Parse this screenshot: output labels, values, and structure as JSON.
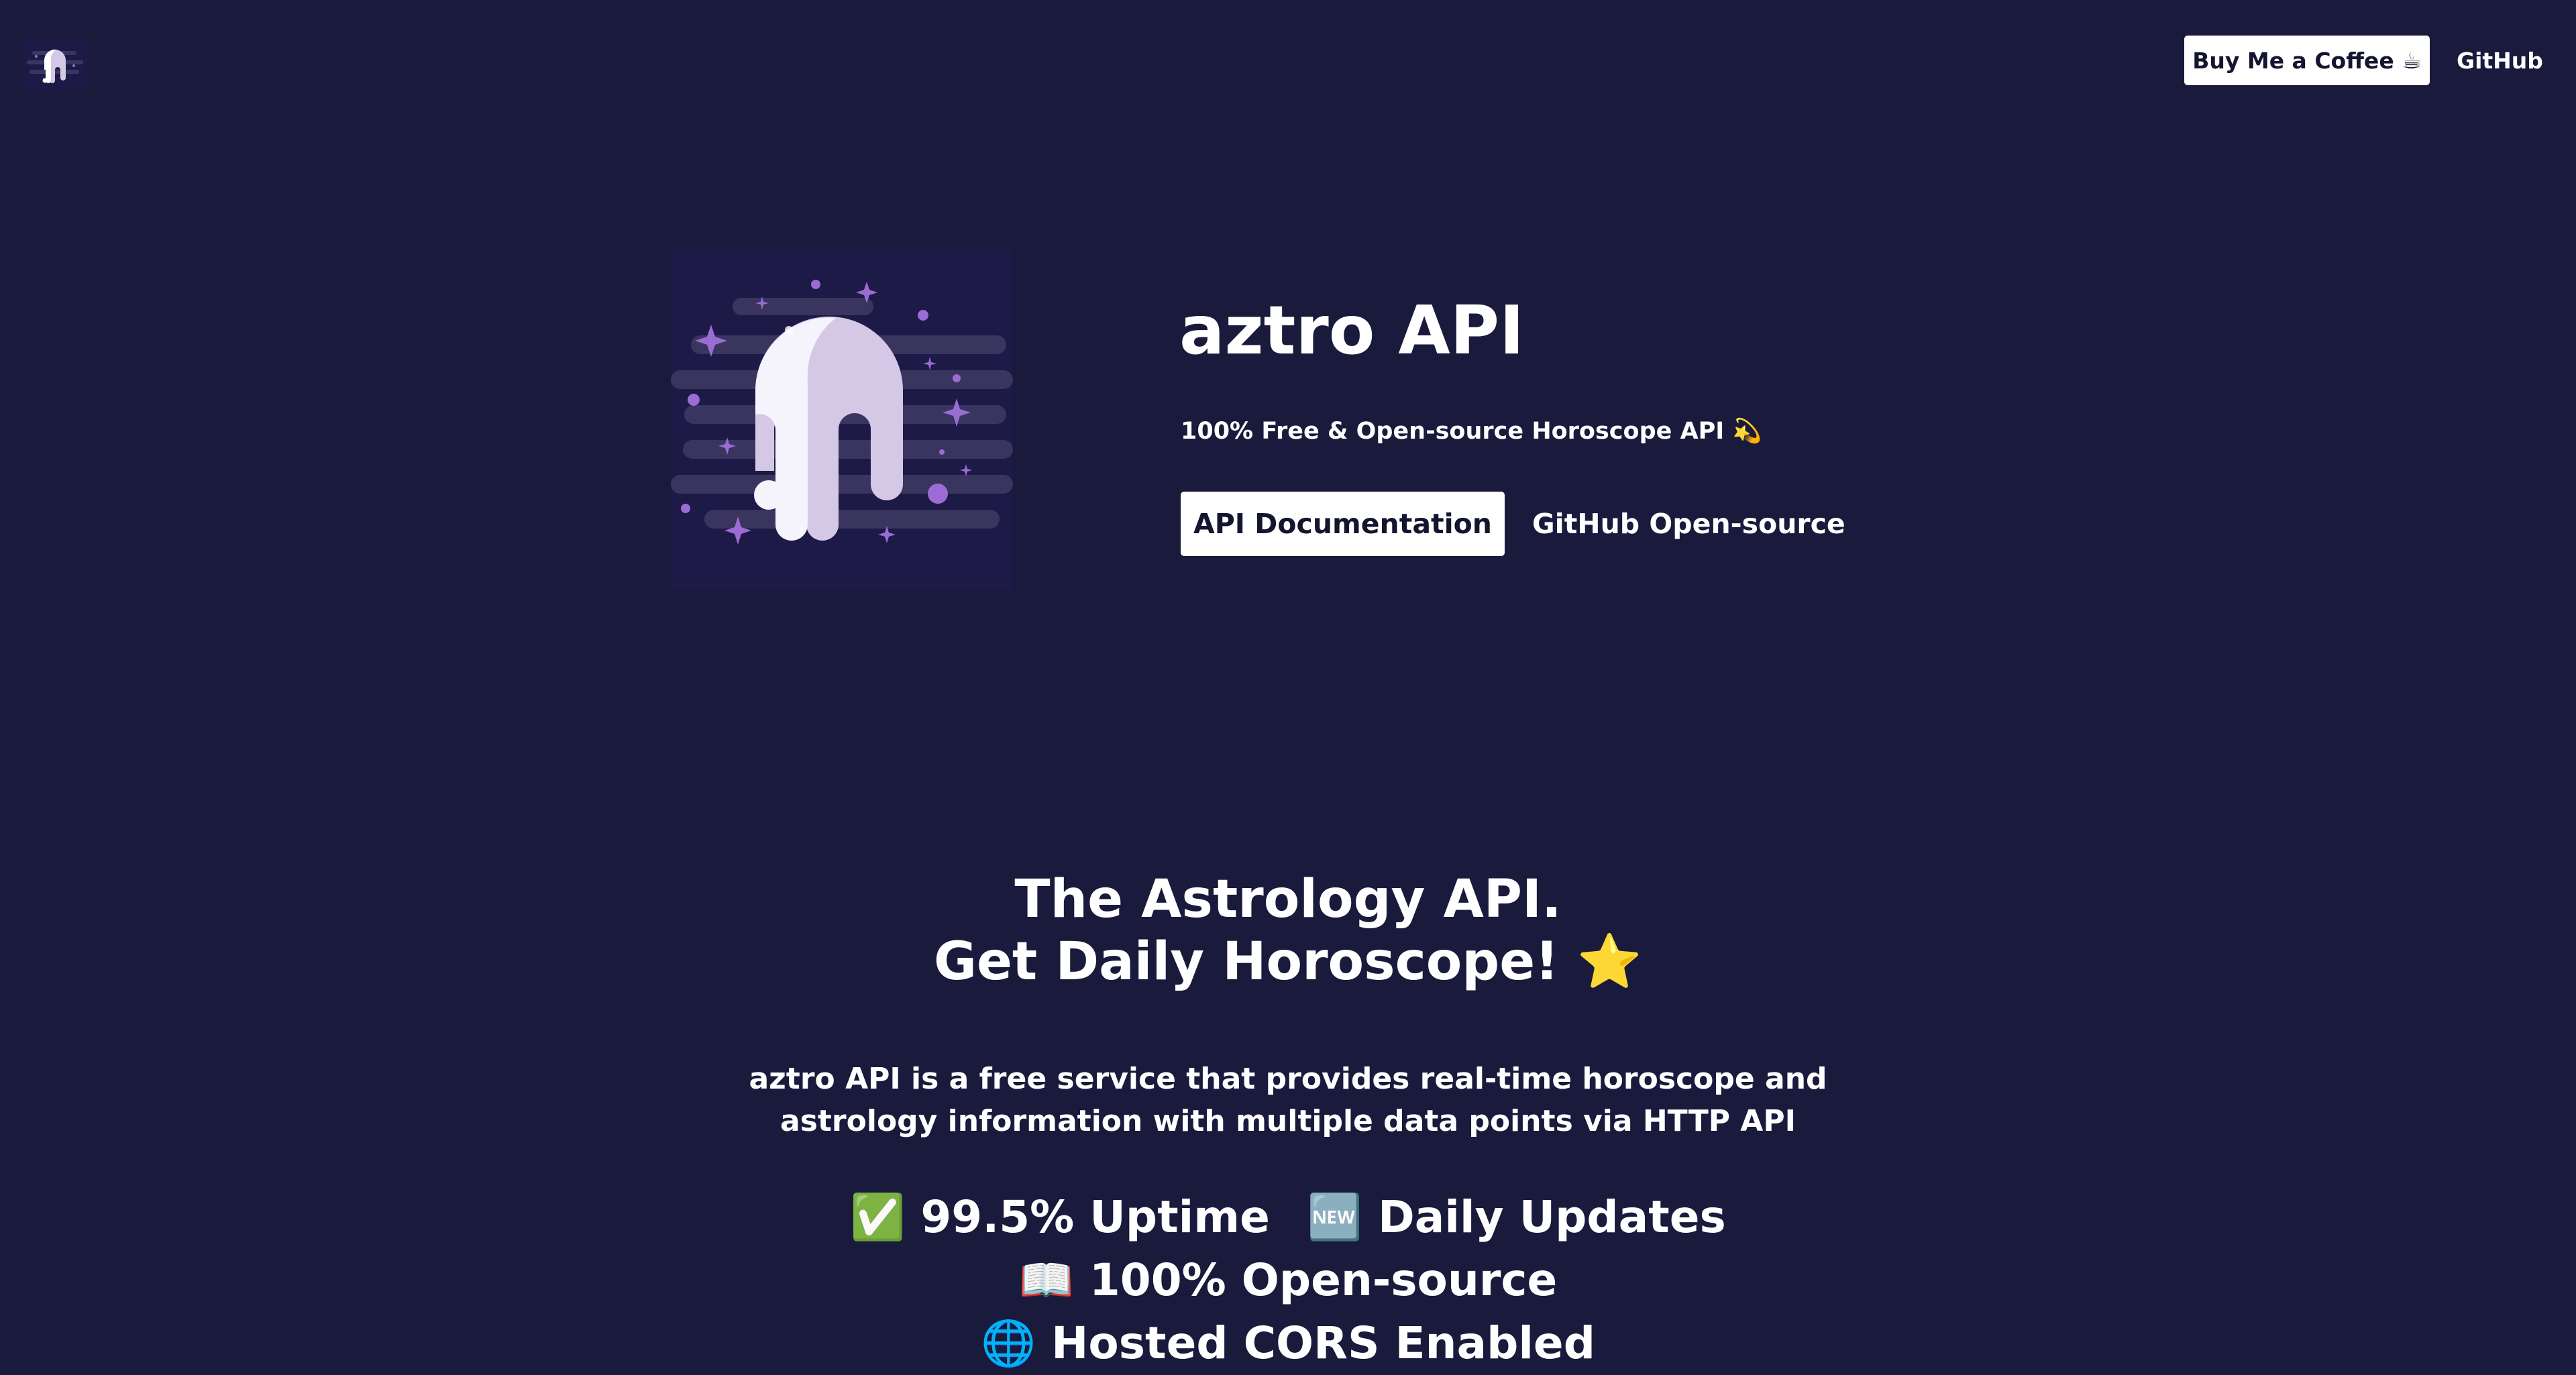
{
  "header": {
    "logo_name": "aztro-logo",
    "coffee_label": "Buy Me a Coffee ☕",
    "github_label": "GitHub"
  },
  "hero": {
    "title": "aztro API",
    "subtitle": "100% Free & Open-source Horoscope API 💫",
    "docs_button_label": "API Documentation",
    "opensource_link_label": "GitHub Open-source"
  },
  "about": {
    "heading_line1": "The Astrology API.",
    "heading_line2": "Get Daily Horoscope! ⭐",
    "description_line1": "aztro API is a free service that provides real-time horoscope and",
    "description_line2": "astrology information with multiple data points via HTTP API",
    "features": [
      "✅ 99.5% Uptime",
      "🆕 Daily Updates",
      "📖 100% Open-source",
      "🌐 Hosted CORS Enabled"
    ]
  },
  "colors": {
    "background": "#191a3c",
    "button_bg": "#ffffff",
    "button_text": "#14152e",
    "art_bg": "#1d1a48",
    "accent_purple": "#9b6cd3",
    "ghost_white": "#f5f3fb",
    "ghost_lilac": "#d4c8e6"
  }
}
